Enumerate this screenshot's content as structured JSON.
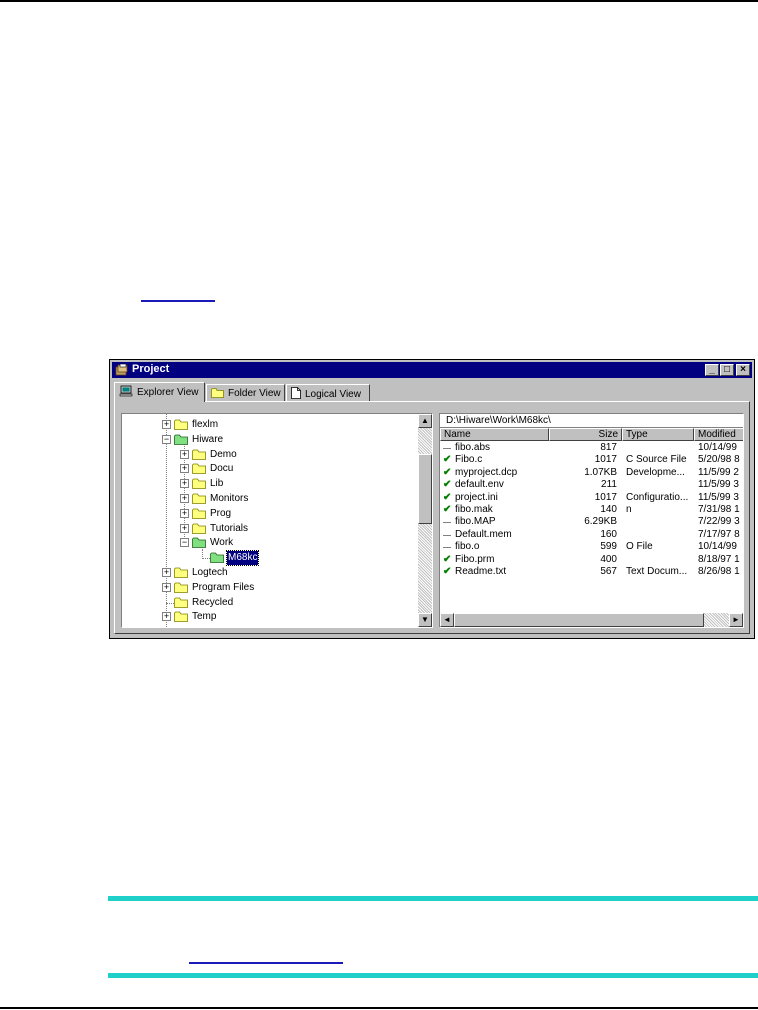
{
  "window": {
    "title": "Project",
    "minimize_symbol": "_",
    "maximize_symbol": "□",
    "close_symbol": "×"
  },
  "tabs": [
    {
      "label": "Explorer View",
      "icon": "computer-icon",
      "active": true
    },
    {
      "label": "Folder View",
      "icon": "folder-icon",
      "active": false
    },
    {
      "label": "Logical View",
      "icon": "document-icon",
      "active": false
    }
  ],
  "tree": {
    "items": [
      {
        "label": "flexlm",
        "expander": "+",
        "level": 0,
        "open": false
      },
      {
        "label": "Hiware",
        "expander": "−",
        "level": 0,
        "open": true
      },
      {
        "label": "Demo",
        "expander": "+",
        "level": 1,
        "open": false
      },
      {
        "label": "Docu",
        "expander": "+",
        "level": 1,
        "open": false
      },
      {
        "label": "Lib",
        "expander": "+",
        "level": 1,
        "open": false
      },
      {
        "label": "Monitors",
        "expander": "+",
        "level": 1,
        "open": false
      },
      {
        "label": "Prog",
        "expander": "+",
        "level": 1,
        "open": false
      },
      {
        "label": "Tutorials",
        "expander": "+",
        "level": 1,
        "open": false
      },
      {
        "label": "Work",
        "expander": "−",
        "level": 1,
        "open": true
      },
      {
        "label": "M68kc",
        "expander": "",
        "level": 2,
        "open": true,
        "selected": true
      },
      {
        "label": "Logtech",
        "expander": "+",
        "level": 0,
        "open": false
      },
      {
        "label": "Program Files",
        "expander": "+",
        "level": 0,
        "open": false
      },
      {
        "label": "Recycled",
        "expander": "",
        "level": 0,
        "open": false
      },
      {
        "label": "Temp",
        "expander": "+",
        "level": 0,
        "open": false
      }
    ],
    "scroll_up": "▲",
    "scroll_down": "▼"
  },
  "list": {
    "path": "D:\\Hiware\\Work\\M68kc\\",
    "columns": [
      "Name",
      "Size",
      "Type",
      "Modified"
    ],
    "files": [
      {
        "name": "fibo.abs",
        "size": "817",
        "type": "",
        "modified": "10/14/99",
        "checked": false
      },
      {
        "name": "Fibo.c",
        "size": "1017",
        "type": "C Source File",
        "modified": "5/20/98 8",
        "checked": true
      },
      {
        "name": "myproject.dcp",
        "size": "1.07KB",
        "type": "Developme...",
        "modified": "11/5/99 2",
        "checked": true
      },
      {
        "name": "default.env",
        "size": "211",
        "type": "",
        "modified": "11/5/99 3",
        "checked": true
      },
      {
        "name": "project.ini",
        "size": "1017",
        "type": "Configuratio...",
        "modified": "11/5/99 3",
        "checked": true
      },
      {
        "name": "fibo.mak",
        "size": "140",
        "type": "n",
        "modified": "7/31/98 1",
        "checked": true
      },
      {
        "name": "fibo.MAP",
        "size": "6.29KB",
        "type": "",
        "modified": "7/22/99 3",
        "checked": false
      },
      {
        "name": "Default.mem",
        "size": "160",
        "type": "",
        "modified": "7/17/97 8",
        "checked": false
      },
      {
        "name": "fibo.o",
        "size": "599",
        "type": "O File",
        "modified": "10/14/99",
        "checked": false
      },
      {
        "name": "Fibo.prm",
        "size": "400",
        "type": "",
        "modified": "8/18/97 1",
        "checked": true
      },
      {
        "name": "Readme.txt",
        "size": "567",
        "type": "Text Docum...",
        "modified": "8/26/98 1",
        "checked": true
      }
    ],
    "check_glyph": "✔",
    "scroll_left": "◄",
    "scroll_right": "►"
  },
  "colors": {
    "titlebar": "#000080",
    "selection": "#000080",
    "folder": "#ffff80",
    "open_folder": "#80e080",
    "check": "#008000",
    "teal_rule": "#1fd0c8",
    "link_underline": "#1a1ab8"
  }
}
